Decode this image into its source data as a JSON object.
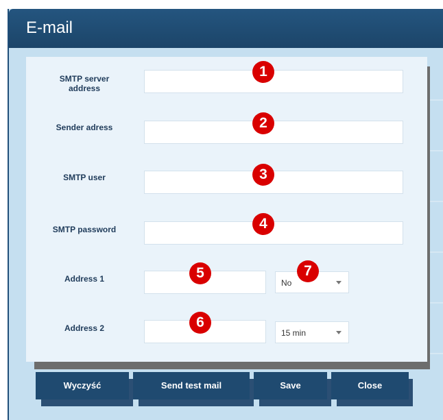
{
  "window": {
    "title": "E-mail"
  },
  "form": {
    "smtp_server_label": "SMTP server\naddress",
    "sender_label": "Sender adress",
    "smtp_user_label": "SMTP user",
    "smtp_password_label": "SMTP password",
    "address1_label": "Address 1",
    "address2_label": "Address 2",
    "smtp_server_value": "",
    "sender_value": "",
    "smtp_user_value": "",
    "smtp_password_value": "",
    "address1_value": "",
    "address2_value": "",
    "address1_interval": "No",
    "address2_interval": "15 min"
  },
  "badges": [
    "1",
    "2",
    "3",
    "4",
    "5",
    "6",
    "7"
  ],
  "buttons": {
    "clear": "Wyczyść",
    "test": "Send test mail",
    "save": "Save",
    "close": "Close"
  },
  "colors": {
    "title_bar": "#1f4a70",
    "window_bg": "#c5dff0",
    "panel_bg": "#eaf3fa",
    "badge": "#d90000"
  }
}
